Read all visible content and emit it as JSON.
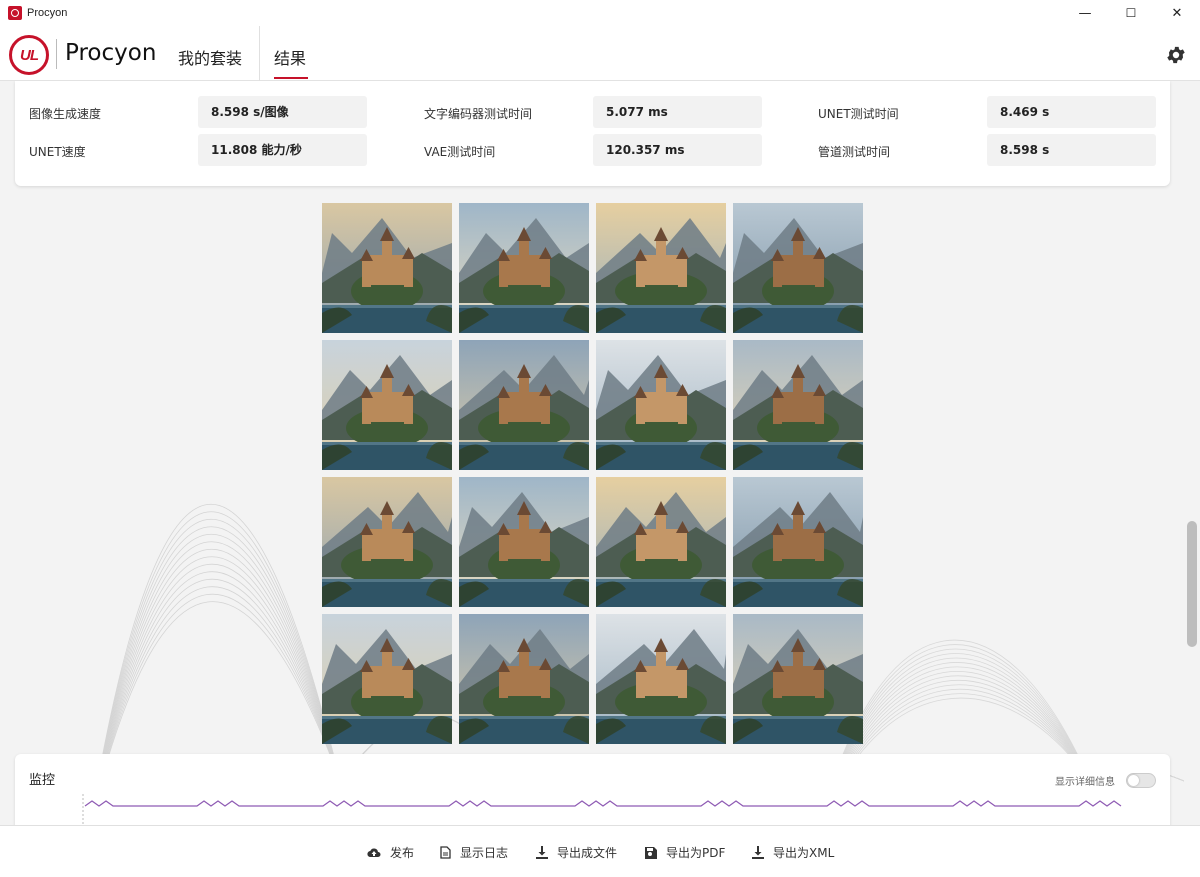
{
  "window": {
    "title": "Procyon",
    "minimize": "—",
    "maximize": "☐",
    "close": "✕"
  },
  "header": {
    "brand": "Procyon",
    "logo_text": "UL",
    "tabs": [
      {
        "label": "我的套装"
      },
      {
        "label": "结果",
        "active": true
      }
    ],
    "settings_icon": "gear-icon"
  },
  "metrics": [
    {
      "label": "图像生成速度",
      "value": "8.598 s/图像"
    },
    {
      "label": "文字编码器测试时间",
      "value": "5.077 ms"
    },
    {
      "label": "UNET测试时间",
      "value": "8.469 s"
    },
    {
      "label": "UNET速度",
      "value": "11.808 能力/秒"
    },
    {
      "label": "VAE测试时间",
      "value": "120.357 ms"
    },
    {
      "label": "管道测试时间",
      "value": "8.598 s"
    }
  ],
  "gallery": {
    "rows": 4,
    "cols": 4,
    "subject": "castle-landscape-image"
  },
  "monitor": {
    "title": "监控",
    "details_label": "显示详细信息",
    "details_enabled": false
  },
  "footer": {
    "buttons": [
      {
        "label": "发布",
        "icon": "cloud-upload-icon"
      },
      {
        "label": "显示日志",
        "icon": "document-icon"
      },
      {
        "label": "导出成文件",
        "icon": "download-icon"
      },
      {
        "label": "导出为PDF",
        "icon": "save-icon"
      },
      {
        "label": "导出为XML",
        "icon": "download-icon"
      }
    ]
  },
  "colors": {
    "accent": "#c6122a",
    "monitor_line": "#8e5ab3"
  }
}
